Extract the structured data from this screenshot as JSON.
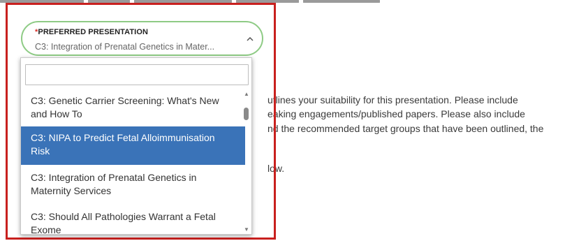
{
  "background": {
    "line1": "utlines your suitability for this presentation. Please include",
    "line2": "eaking engagements/published papers. Please also include",
    "line3": "nd the recommended target groups that have been outlined, the",
    "line4": "low."
  },
  "field": {
    "required_mark": "*",
    "label": "PREFERRED PRESENTATION",
    "value": "C3: Integration of Prenatal Genetics in Mater...",
    "chevron_icon": "chevron-up-icon"
  },
  "dropdown": {
    "search_value": "",
    "options": [
      {
        "line1": "C3: Genetic Carrier Screening: What's New",
        "line2": "and How To",
        "selected": false
      },
      {
        "line1": "C3: NIPA to Predict Fetal Alloimmunisation",
        "line2": "Risk",
        "selected": true
      },
      {
        "line1": "C3: Integration of Prenatal Genetics in",
        "line2": "Maternity Services",
        "selected": false
      },
      {
        "line1": "C3: Should All Pathologies Warrant a Fetal",
        "line2": "Exome",
        "selected": false
      }
    ]
  },
  "colors": {
    "highlight": "#3a73b8",
    "frame": "#c8201e",
    "field_border": "#8ecb85"
  }
}
